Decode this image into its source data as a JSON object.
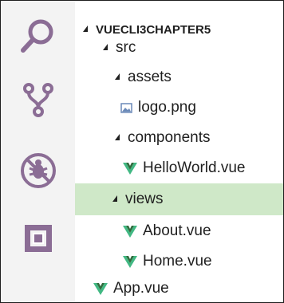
{
  "activity_bar": {
    "items": [
      {
        "name": "search-icon"
      },
      {
        "name": "source-control-icon"
      },
      {
        "name": "debug-icon"
      },
      {
        "name": "extensions-icon"
      }
    ],
    "icon_color": "#8b6d95"
  },
  "explorer": {
    "root_label": "VUECLI3CHAPTER5",
    "items": [
      {
        "label": "src",
        "type": "folder",
        "expanded": true
      },
      {
        "label": "assets",
        "type": "folder",
        "expanded": true
      },
      {
        "label": "logo.png",
        "type": "image",
        "icon": "image-file-icon"
      },
      {
        "label": "components",
        "type": "folder",
        "expanded": true
      },
      {
        "label": "HelloWorld.vue",
        "type": "vue",
        "icon": "vue-file-icon"
      },
      {
        "label": "views",
        "type": "folder",
        "expanded": true,
        "selected": true
      },
      {
        "label": "About.vue",
        "type": "vue",
        "icon": "vue-file-icon"
      },
      {
        "label": "Home.vue",
        "type": "vue",
        "icon": "vue-file-icon"
      },
      {
        "label": "App.vue",
        "type": "vue",
        "icon": "vue-file-icon"
      }
    ],
    "selected_color": "#cfe8c8",
    "vue_color": "#41b883",
    "image_icon_color": "#6a89b8"
  }
}
